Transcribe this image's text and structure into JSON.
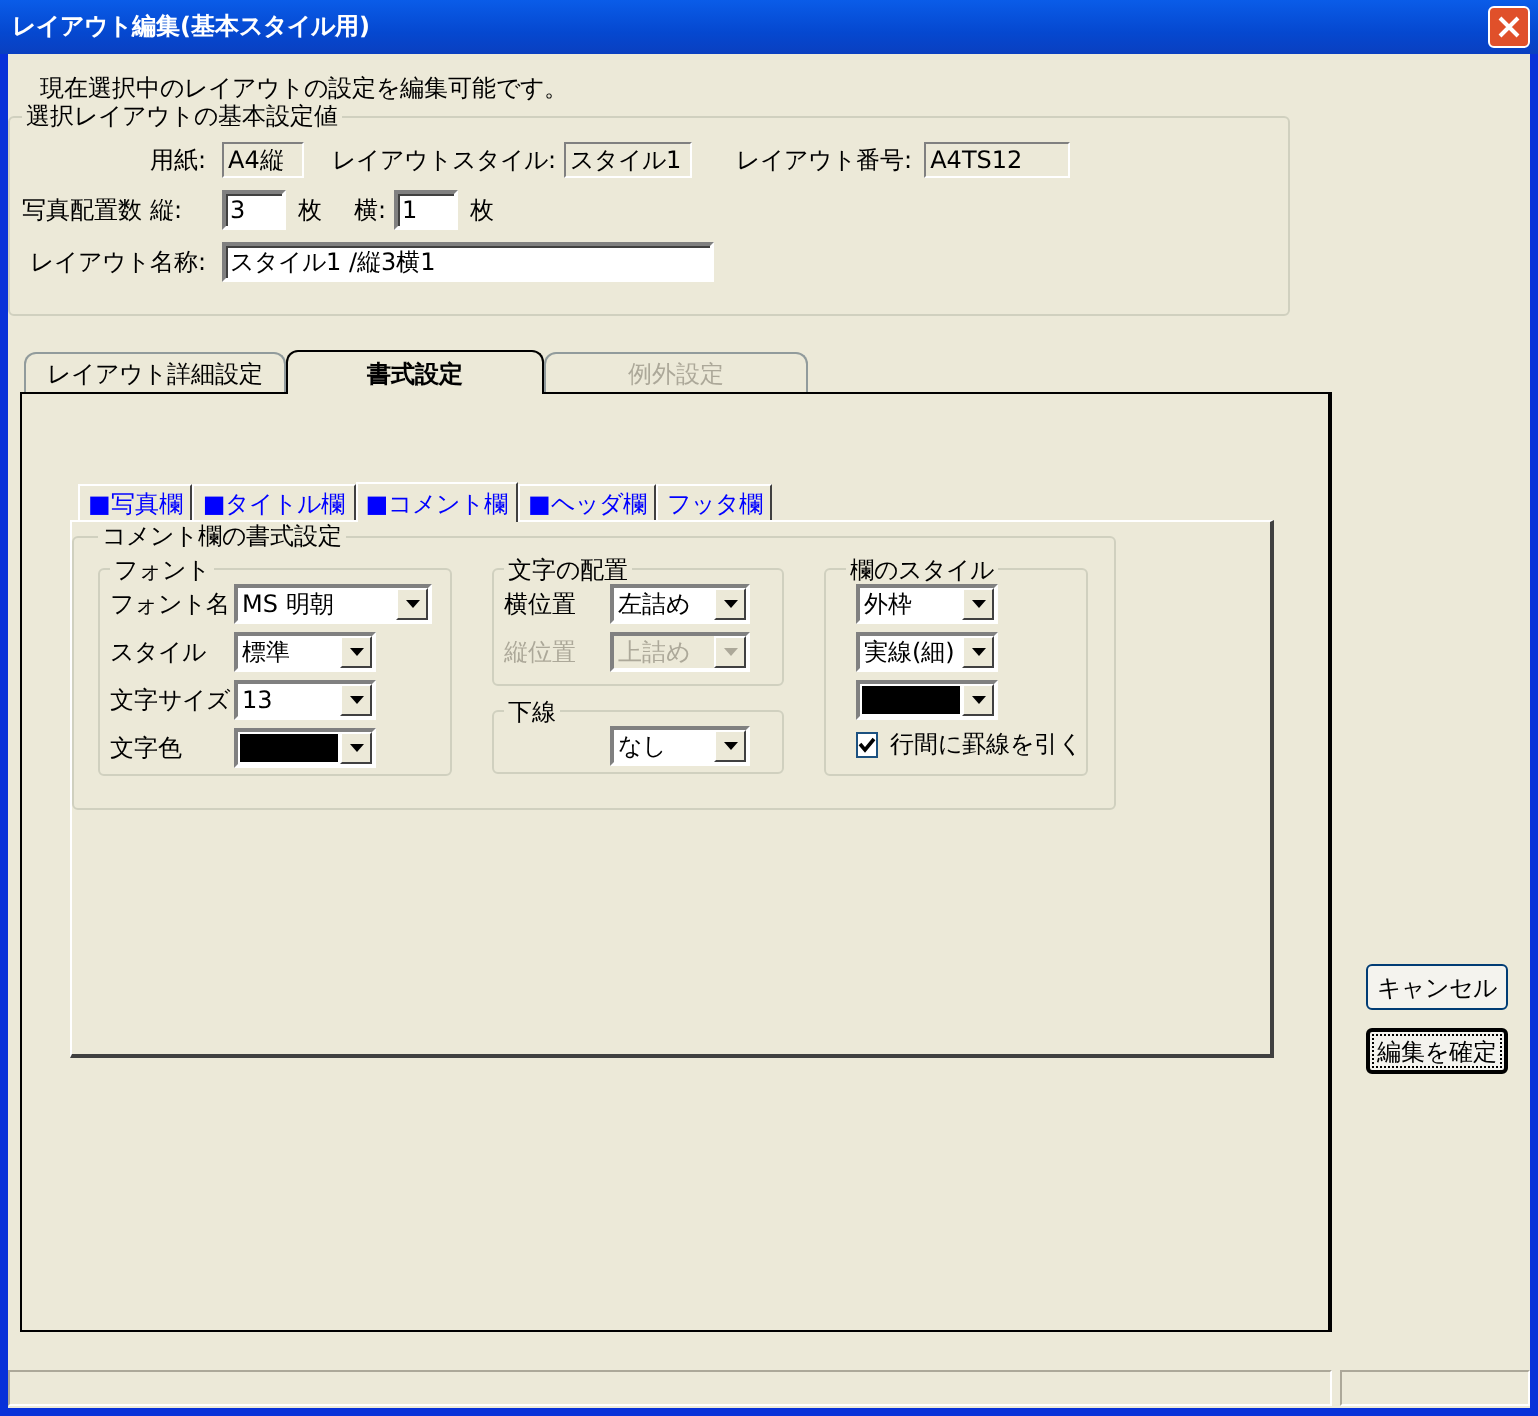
{
  "window": {
    "title": "レイアウト編集(基本スタイル用)"
  },
  "description": "現在選択中のレイアウトの設定を編集可能です。",
  "basic_settings": {
    "title": "選択レイアウトの基本設定値",
    "paper": {
      "label": "用紙:",
      "value": "A4縦"
    },
    "layout_style": {
      "label": "レイアウトスタイル:",
      "value": "スタイル1"
    },
    "layout_number": {
      "label": "レイアウト番号:",
      "value": "A4TS12"
    },
    "photo_count": {
      "label": "写真配置数",
      "vertical_label": "縦:",
      "vertical_value": "3",
      "vertical_unit": "枚",
      "horizontal_label": "横:",
      "horizontal_value": "1",
      "horizontal_unit": "枚"
    },
    "layout_name": {
      "label": "レイアウト名称:",
      "value": "スタイル1 /縦3横1"
    }
  },
  "tabs": [
    {
      "label": "レイアウト詳細設定",
      "selected": false,
      "disabled": false
    },
    {
      "label": "書式設定",
      "selected": true,
      "disabled": false
    },
    {
      "label": "例外設定",
      "selected": false,
      "disabled": true
    }
  ],
  "sub_tabs": [
    {
      "label": "■写真欄",
      "selected": false
    },
    {
      "label": "■タイトル欄",
      "selected": false
    },
    {
      "label": "■コメント欄",
      "selected": true
    },
    {
      "label": "■ヘッダ欄",
      "selected": false
    },
    {
      "label": "フッタ欄",
      "selected": false
    }
  ],
  "format_group": {
    "title": "コメント欄の書式設定",
    "font": {
      "title": "フォント",
      "rows": [
        {
          "label": "フォント名",
          "kind": "text",
          "value": "MS 明朝"
        },
        {
          "label": "スタイル",
          "kind": "text",
          "value": "標準"
        },
        {
          "label": "文字サイズ",
          "kind": "text",
          "value": "13"
        },
        {
          "label": "文字色",
          "kind": "color",
          "color": "#000000"
        }
      ]
    },
    "alignment": {
      "title": "文字の配置",
      "rows": [
        {
          "label": "横位置",
          "value": "左詰め",
          "disabled": false
        },
        {
          "label": "縦位置",
          "value": "上詰め",
          "disabled": true
        }
      ]
    },
    "underline": {
      "title": "下線",
      "value": "なし"
    },
    "frame_style": {
      "title": "欄のスタイル",
      "rows": [
        {
          "kind": "text",
          "value": "外枠"
        },
        {
          "kind": "text",
          "value": "実線(細)"
        },
        {
          "kind": "color",
          "color": "#000000"
        }
      ],
      "checkbox": {
        "label": "行間に罫線を引く",
        "checked": true
      }
    }
  },
  "buttons": [
    {
      "label": "キャンセル",
      "default": false
    },
    {
      "label": "編集を確定",
      "default": true
    }
  ]
}
